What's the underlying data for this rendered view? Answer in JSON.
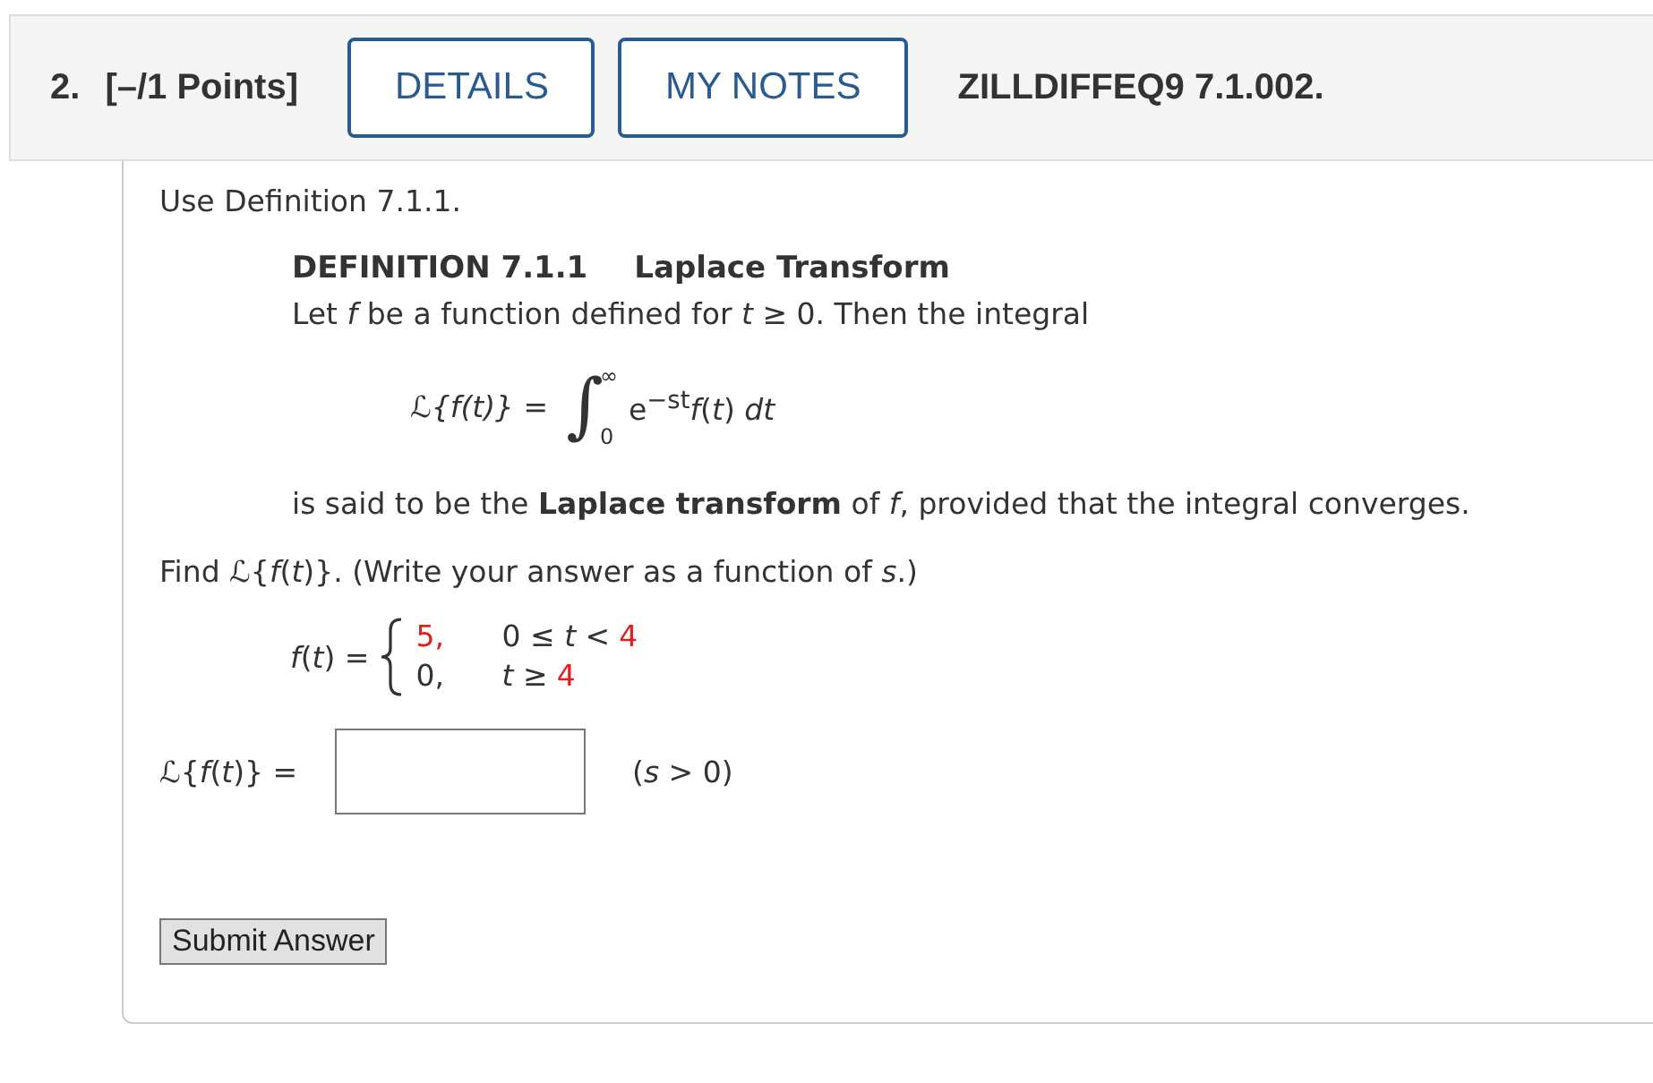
{
  "header": {
    "number": "2.",
    "points": "[–/1 Points]",
    "buttons": [
      "DETAILS",
      "MY NOTES"
    ],
    "problem_id": "ZILLDIFFEQ9 7.1.002."
  },
  "instruction": "Use Definition 7.1.1.",
  "definition": {
    "label": "DEFINITION 7.1.1",
    "title": "Laplace Transform",
    "intro": "Let *f* be a function defined for *t* ≥ 0. Then the integral",
    "formula": {
      "lhs": "ℒ{*f*(*t*)} =",
      "integral": "∫",
      "upper": "∞",
      "lower": "0",
      "integrand": "e$^{−st}$*f*(*t*) *dt*"
    },
    "conclusion": "is said to be the **Laplace transform** of *f*, provided that the integral converges."
  },
  "question": "Find ℒ{*f*(*t*)}. (Write your answer as a function of *s*.)",
  "piecewise": {
    "lhs": "*f*(*t*) =",
    "cases": [
      {
        "value": "5,",
        "value_highlighted": true,
        "condition": "0 ≤ *t* <",
        "bound": "4"
      },
      {
        "value": "0,",
        "value_highlighted": false,
        "condition": "*t* ≥",
        "bound": "4"
      }
    ]
  },
  "answer": {
    "label": "ℒ{*f*(*t*)} =",
    "note": "(*s* > 0)"
  },
  "submit": "Submit Answer"
}
